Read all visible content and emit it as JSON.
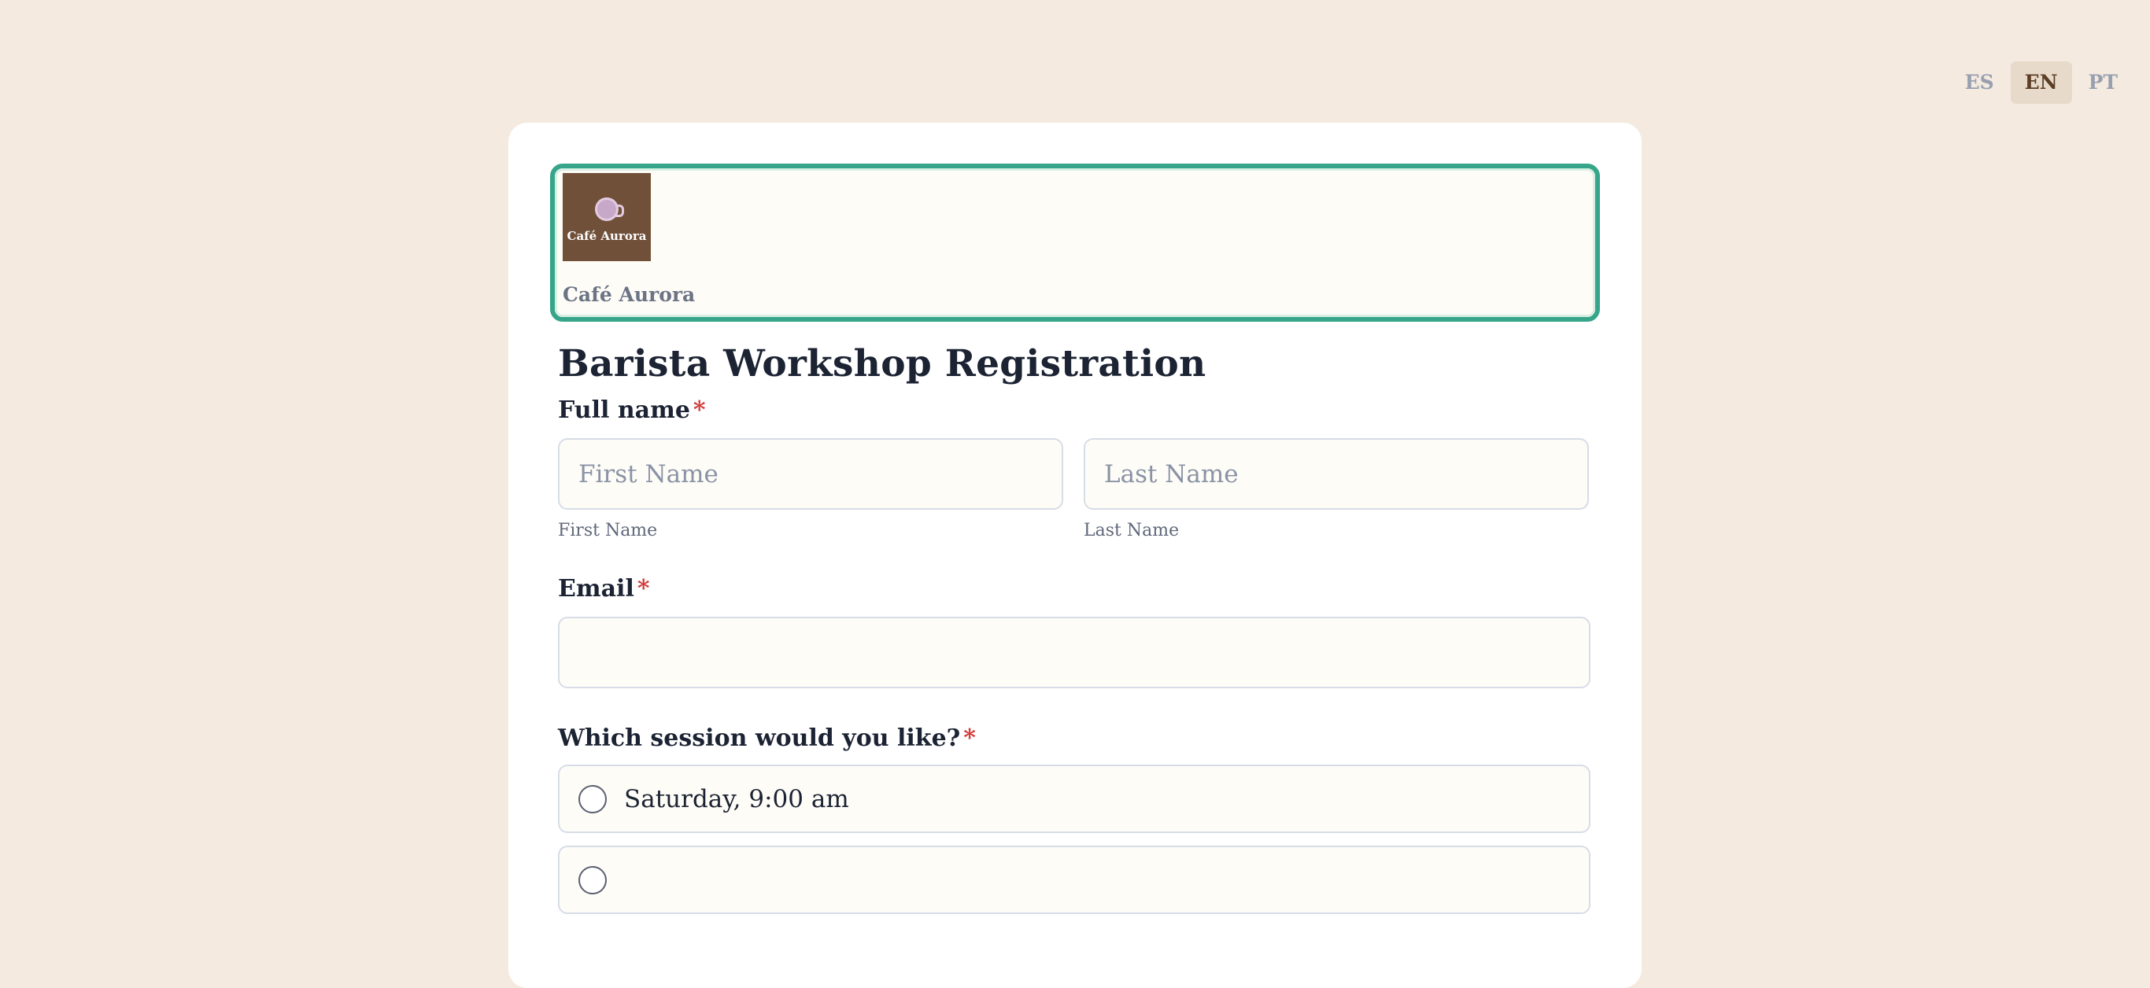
{
  "languages": [
    {
      "code": "ES",
      "active": false
    },
    {
      "code": "EN",
      "active": true
    },
    {
      "code": "PT",
      "active": false
    }
  ],
  "header": {
    "logo_text": "Café Aurora",
    "brand_name": "Café Aurora"
  },
  "form": {
    "title": "Barista Workshop Registration",
    "required_marker": "*",
    "full_name": {
      "label": "Full name",
      "first": {
        "placeholder": "First Name",
        "sublabel": "First Name",
        "value": ""
      },
      "last": {
        "placeholder": "Last Name",
        "sublabel": "Last Name",
        "value": ""
      }
    },
    "email": {
      "label": "Email",
      "value": "",
      "placeholder": ""
    },
    "session": {
      "label": "Which session would you like?",
      "options": [
        {
          "label": "Saturday, 9:00 am",
          "selected": false
        },
        {
          "label": "",
          "selected": false
        }
      ]
    }
  },
  "colors": {
    "page_bg": "#f4eadf",
    "card_bg": "#ffffff",
    "header_border": "#37a58a",
    "logo_bg": "#705039",
    "required": "#d43a3a",
    "active_lang_bg": "#e8dacb"
  }
}
